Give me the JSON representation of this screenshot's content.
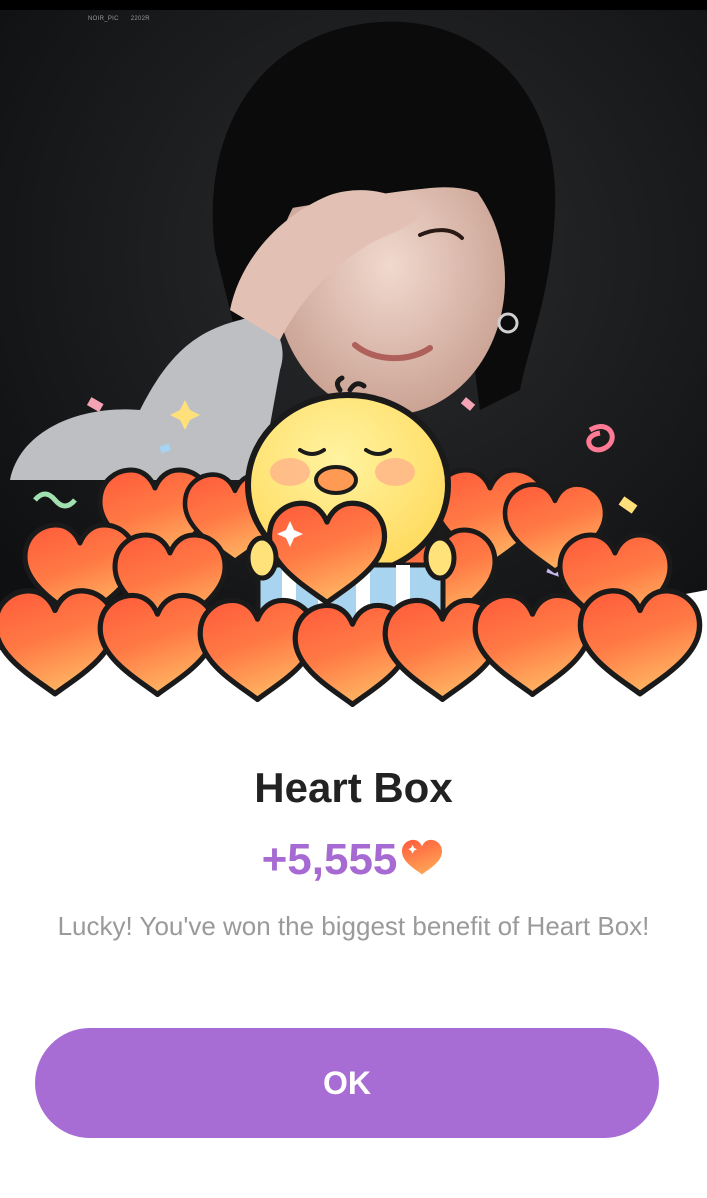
{
  "hero": {
    "watermark_left": "NOIR_PIC",
    "watermark_right": "2202R"
  },
  "dialog": {
    "title": "Heart Box",
    "reward_amount": "+5,555",
    "reward_icon": "heart-icon",
    "message": "Lucky! You've won the biggest benefit of Heart Box!",
    "ok_label": "OK"
  },
  "colors": {
    "accent_purple": "#a86dd5",
    "reward_text": "#a66ad2",
    "heart_orange": "#ff6a3d",
    "title_text": "#222222",
    "message_text": "#9a9a9a"
  }
}
